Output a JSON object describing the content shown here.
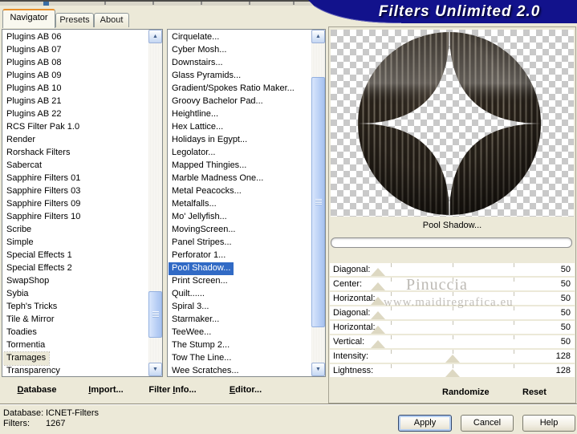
{
  "window": {
    "title": "Filters Unlimited 2.0"
  },
  "tabs": [
    {
      "label": "Navigator",
      "active": true
    },
    {
      "label": "Presets",
      "active": false
    },
    {
      "label": "About",
      "active": false
    }
  ],
  "navigator_list": {
    "items": [
      "Plugins AB 06",
      "Plugins AB 07",
      "Plugins AB 08",
      "Plugins AB 09",
      "Plugins AB 10",
      "Plugins AB 21",
      "Plugins AB 22",
      "RCS Filter Pak 1.0",
      "Render",
      "Rorshack Filters",
      "Sabercat",
      "Sapphire Filters 01",
      "Sapphire Filters 03",
      "Sapphire Filters 09",
      "Sapphire Filters 10",
      "Scribe",
      "Simple",
      "Special Effects 1",
      "Special Effects 2",
      "SwapShop",
      "Sybia",
      "Teph's Tricks",
      "Tile & Mirror",
      "Toadies",
      "Tormentia",
      "Tramages",
      "Transparency"
    ],
    "selected": "Tramages"
  },
  "filter_list": {
    "items": [
      "Cirquelate...",
      "Cyber Mosh...",
      "Downstairs...",
      "Glass Pyramids...",
      "Gradient/Spokes Ratio Maker...",
      "Groovy Bachelor Pad...",
      "Heightline...",
      "Hex Lattice...",
      "Holidays in Egypt...",
      "Legolator...",
      "Mapped Thingies...",
      "Marble Madness One...",
      "Metal Peacocks...",
      "Metalfalls...",
      "Mo' Jellyfish...",
      "MovingScreen...",
      "Panel Stripes...",
      "Perforator 1...",
      "Pool Shadow...",
      "Print Screen...",
      "Quilt......",
      "Spiral 3...",
      "Starmaker...",
      "TeeWee...",
      "The Stump 2...",
      "Tow The Line...",
      "Wee Scratches..."
    ],
    "selected": "Pool Shadow..."
  },
  "preview": {
    "caption": "Pool Shadow..."
  },
  "slider_range": {
    "min": 0,
    "max": 255
  },
  "sliders": [
    {
      "label": "Diagonal:",
      "value": 50
    },
    {
      "label": "Center:",
      "value": 50
    },
    {
      "label": "Horizontal:",
      "value": 50
    },
    {
      "label": "Diagonal:",
      "value": 50
    },
    {
      "label": "Horizontal:",
      "value": 50
    },
    {
      "label": "Vertical:",
      "value": 50
    },
    {
      "label": "Intensity:",
      "value": 128
    },
    {
      "label": "Lightness:",
      "value": 128
    }
  ],
  "panel_buttons": {
    "randomize": "Randomize",
    "reset": "Reset"
  },
  "toolbar": {
    "database": {
      "label": "Database",
      "accel_index": 0
    },
    "import": {
      "label": "Import...",
      "accel_index": 0
    },
    "filter_info": {
      "label": "Filter Info...",
      "accel_index": 7
    },
    "editor": {
      "label": "Editor...",
      "accel_index": 0
    }
  },
  "status": {
    "database_label": "Database:",
    "database_value": "ICNET-Filters",
    "filters_label": "Filters:",
    "filters_value": "1267"
  },
  "dialog_buttons": {
    "apply": "Apply",
    "cancel": "Cancel",
    "help": "Help"
  },
  "watermark": {
    "line1": "Pinuccia",
    "line2": "www.maidiregrafica.eu"
  },
  "icons": {
    "scroll_up": "▲",
    "scroll_down": "▼"
  },
  "colors": {
    "banner": "#12128c",
    "selection": "#316ac5",
    "tab_accent": "#e8912d",
    "dialog_bg": "#ece9d8"
  }
}
